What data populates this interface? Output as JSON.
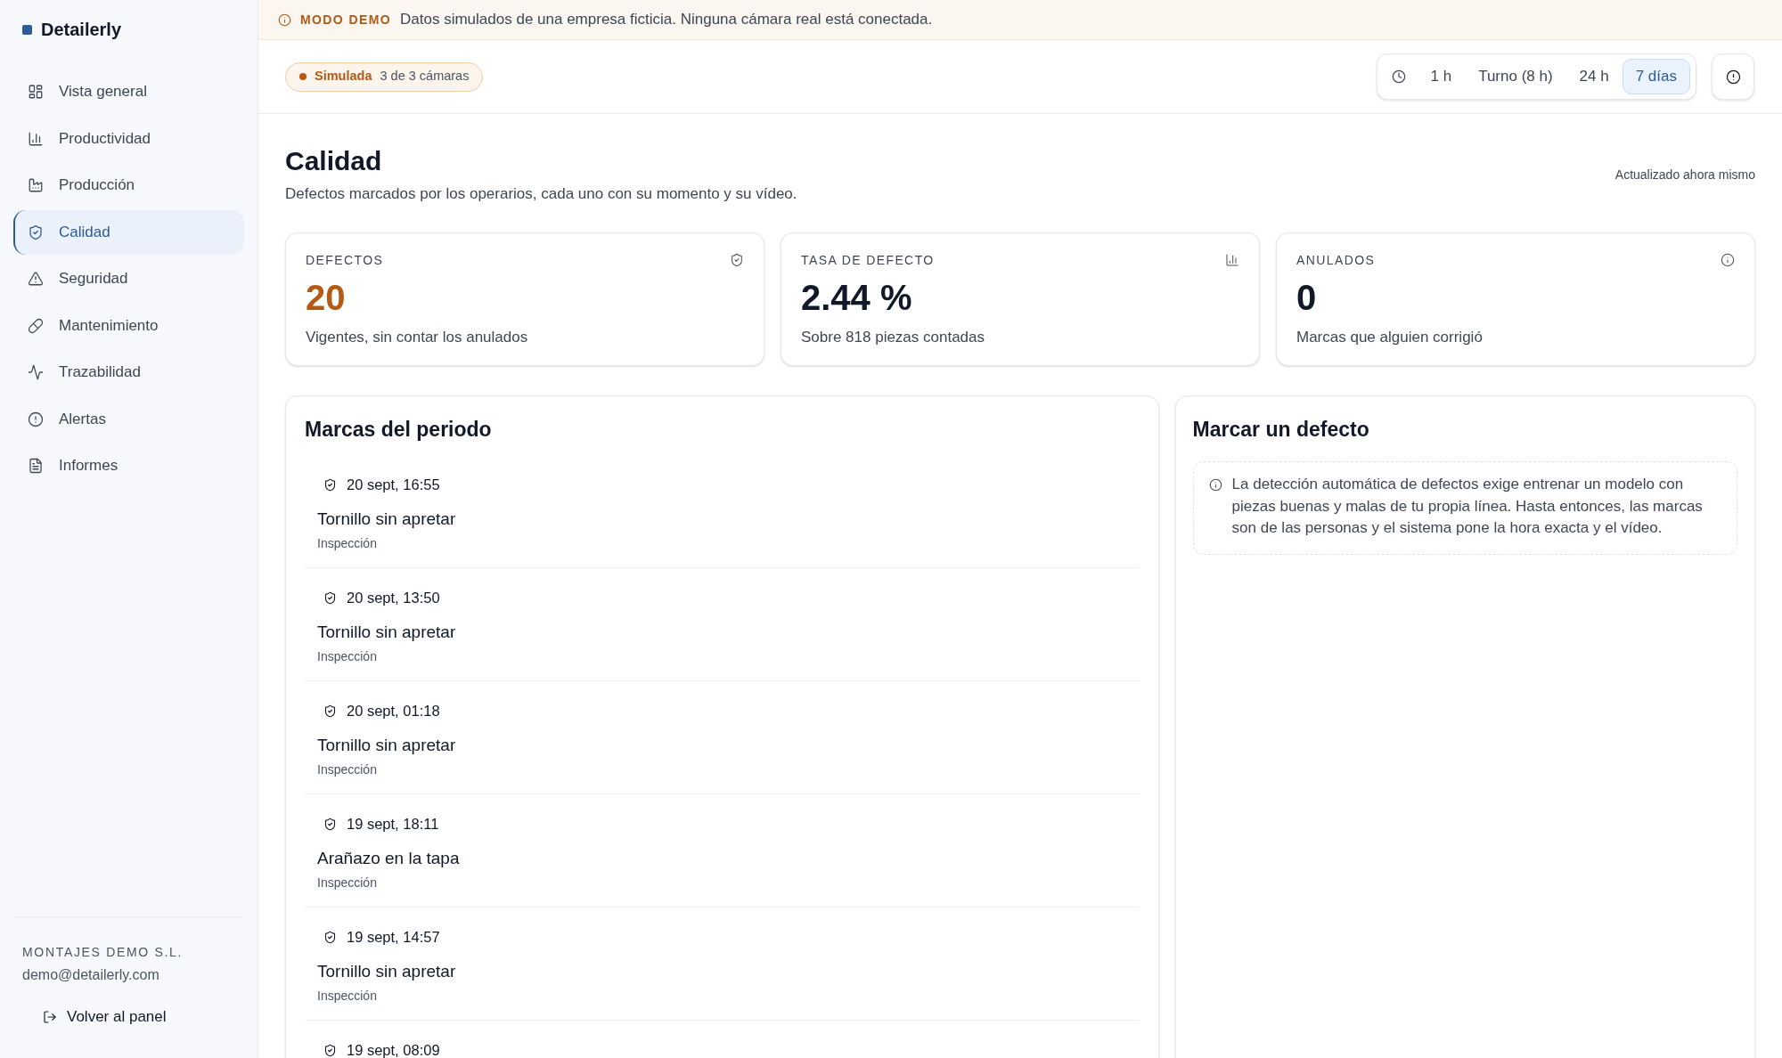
{
  "sidebar": {
    "brand": "Detailerly",
    "items": [
      {
        "label": "Vista general",
        "selected": false
      },
      {
        "label": "Productividad",
        "selected": false
      },
      {
        "label": "Producción",
        "selected": false
      },
      {
        "label": "Calidad",
        "selected": true
      },
      {
        "label": "Seguridad",
        "selected": false
      },
      {
        "label": "Mantenimiento",
        "selected": false
      },
      {
        "label": "Trazabilidad",
        "selected": false
      },
      {
        "label": "Alertas",
        "selected": false
      },
      {
        "label": "Informes",
        "selected": false
      }
    ],
    "account": {
      "company": "MONTAJES DEMO S.L.",
      "email": "demo@detailerly.com"
    },
    "back_link": "Volver al panel"
  },
  "banner": {
    "label": "MODO DEMO",
    "message": "Datos simulados de una empresa ficticia. Ninguna cámara real está conectada."
  },
  "toolbar": {
    "status_badge": {
      "label": "Simulada",
      "detail": "3 de 3 cámaras"
    },
    "time_ranges": [
      {
        "label": "1 h",
        "selected": false
      },
      {
        "label": "Turno (8 h)",
        "selected": false
      },
      {
        "label": "24 h",
        "selected": false
      },
      {
        "label": "7 días",
        "selected": true
      }
    ]
  },
  "header": {
    "title": "Calidad",
    "subtitle": "Defectos marcados por los operarios, cada uno con su momento y su vídeo.",
    "updated": "Actualizado ahora mismo"
  },
  "kpis": [
    {
      "label": "DEFECTOS",
      "value": "20",
      "description": "Vigentes, sin contar los anulados",
      "color": "#b45a14"
    },
    {
      "label": "TASA DE DEFECTO",
      "value": "2.44 %",
      "description": "Sobre 818 piezas contadas",
      "color": "#111827"
    },
    {
      "label": "ANULADOS",
      "value": "0",
      "description": "Marcas que alguien corrigió",
      "color": "#111827"
    }
  ],
  "marks_panel": {
    "title": "Marcas del periodo",
    "items": [
      {
        "time": "20 sept, 16:55",
        "defect": "Tornillo sin apretar",
        "source": "Inspección"
      },
      {
        "time": "20 sept, 13:50",
        "defect": "Tornillo sin apretar",
        "source": "Inspección"
      },
      {
        "time": "20 sept, 01:18",
        "defect": "Tornillo sin apretar",
        "source": "Inspección"
      },
      {
        "time": "19 sept, 18:11",
        "defect": "Arañazo en la tapa",
        "source": "Inspección"
      },
      {
        "time": "19 sept, 14:57",
        "defect": "Tornillo sin apretar",
        "source": "Inspección"
      },
      {
        "time": "19 sept, 08:09"
      }
    ]
  },
  "mark_form": {
    "title": "Marcar un defecto",
    "notice": "La detección automática de defectos exige entrenar un modelo con piezas buenas y malas de tu propia línea. Hasta entonces, las marcas son de las personas y el sistema pone la hora exacta y el vídeo."
  }
}
